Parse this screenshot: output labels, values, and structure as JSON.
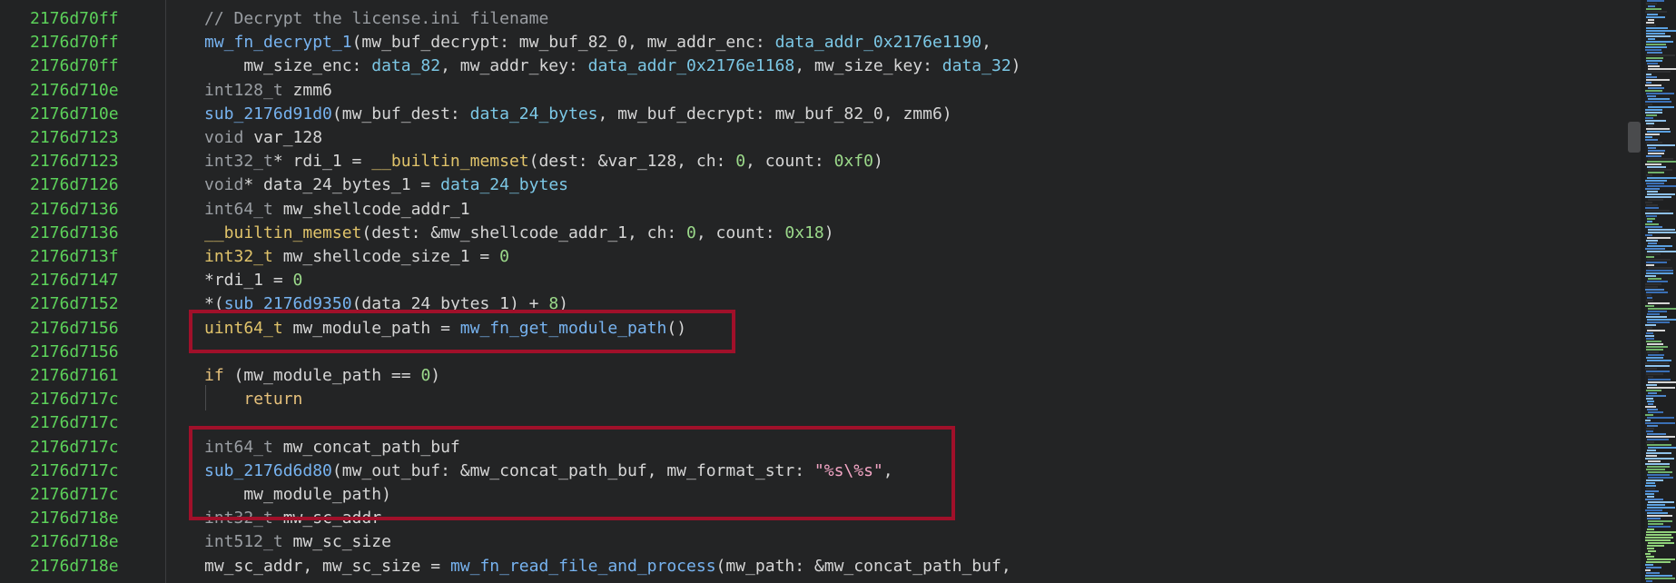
{
  "accent": "#a0102a",
  "line_numbers": [
    "2176d70ff",
    "2176d70ff",
    "2176d70ff",
    "2176d710e",
    "2176d710e",
    "2176d7123",
    "2176d7123",
    "2176d7126",
    "2176d7136",
    "2176d7136",
    "2176d713f",
    "2176d7147",
    "2176d7152",
    "2176d7156",
    "2176d7156",
    "2176d7161",
    "2176d717c",
    "2176d717c",
    "2176d717c",
    "2176d717c",
    "2176d717c",
    "2176d718e",
    "2176d718e",
    "2176d718e"
  ],
  "code_lines": [
    [
      {
        "t": "// Decrypt the license.ini filename",
        "c": "cmt"
      }
    ],
    [
      {
        "t": "mw_fn_decrypt_1",
        "c": "fn"
      },
      {
        "t": "(mw_buf_decrypt: mw_buf_82_0, mw_addr_enc: ",
        "c": "plain"
      },
      {
        "t": "data_addr_0x2176e1190",
        "c": "var"
      },
      {
        "t": ",",
        "c": "plain"
      }
    ],
    [
      {
        "t": "    mw_size_enc: ",
        "c": "plain"
      },
      {
        "t": "data_82",
        "c": "var"
      },
      {
        "t": ", mw_addr_key: ",
        "c": "plain"
      },
      {
        "t": "data_addr_0x2176e1168",
        "c": "var"
      },
      {
        "t": ", mw_size_key: ",
        "c": "plain"
      },
      {
        "t": "data_32",
        "c": "var"
      },
      {
        "t": ")",
        "c": "plain"
      }
    ],
    [
      {
        "t": "int128_t",
        "c": "dim"
      },
      {
        "t": " zmm6",
        "c": "plain"
      }
    ],
    [
      {
        "t": "sub_2176d91d0",
        "c": "fn"
      },
      {
        "t": "(mw_buf_dest: ",
        "c": "plain"
      },
      {
        "t": "data_24_bytes",
        "c": "var"
      },
      {
        "t": ", mw_buf_decrypt: mw_buf_82_0, zmm6)",
        "c": "plain"
      }
    ],
    [
      {
        "t": "void",
        "c": "dim"
      },
      {
        "t": " var_128",
        "c": "plain"
      }
    ],
    [
      {
        "t": "int32_t",
        "c": "dim"
      },
      {
        "t": "* rdi_1 = ",
        "c": "plain"
      },
      {
        "t": "__builtin_memset",
        "c": "type"
      },
      {
        "t": "(dest: &var_128, ch: ",
        "c": "plain"
      },
      {
        "t": "0",
        "c": "num"
      },
      {
        "t": ", count: ",
        "c": "plain"
      },
      {
        "t": "0xf0",
        "c": "num"
      },
      {
        "t": ")",
        "c": "plain"
      }
    ],
    [
      {
        "t": "void",
        "c": "dim"
      },
      {
        "t": "* data_24_bytes_1 = ",
        "c": "plain"
      },
      {
        "t": "data_24_bytes",
        "c": "var"
      }
    ],
    [
      {
        "t": "int64_t",
        "c": "dim"
      },
      {
        "t": " mw_shellcode_addr_1",
        "c": "plain"
      }
    ],
    [
      {
        "t": "__builtin_memset",
        "c": "type"
      },
      {
        "t": "(dest: &mw_shellcode_addr_1, ch: ",
        "c": "plain"
      },
      {
        "t": "0",
        "c": "num"
      },
      {
        "t": ", count: ",
        "c": "plain"
      },
      {
        "t": "0x18",
        "c": "num"
      },
      {
        "t": ")",
        "c": "plain"
      }
    ],
    [
      {
        "t": "int32_t",
        "c": "type"
      },
      {
        "t": " mw_shellcode_size_1 = ",
        "c": "plain"
      },
      {
        "t": "0",
        "c": "num"
      }
    ],
    [
      {
        "t": "*rdi_1 = ",
        "c": "plain"
      },
      {
        "t": "0",
        "c": "num"
      }
    ],
    [
      {
        "t": "*(",
        "c": "plain"
      },
      {
        "t": "sub_2176d9350",
        "c": "fn"
      },
      {
        "t": "(data_24_bytes_1) + ",
        "c": "plain"
      },
      {
        "t": "8",
        "c": "num"
      },
      {
        "t": ")",
        "c": "plain"
      }
    ],
    [
      {
        "t": "uint64_t",
        "c": "type"
      },
      {
        "t": " mw_module_path = ",
        "c": "plain"
      },
      {
        "t": "mw_fn_get_module_path",
        "c": "fn"
      },
      {
        "t": "()",
        "c": "plain"
      }
    ],
    [],
    [
      {
        "t": "if",
        "c": "kw"
      },
      {
        "t": " (mw_module_path == ",
        "c": "plain"
      },
      {
        "t": "0",
        "c": "num"
      },
      {
        "t": ")",
        "c": "plain"
      }
    ],
    [
      {
        "t": "    ",
        "c": "plain"
      },
      {
        "t": "return",
        "c": "kw"
      }
    ],
    [],
    [
      {
        "t": "int64_t",
        "c": "dim"
      },
      {
        "t": " mw_concat_path_buf",
        "c": "plain"
      }
    ],
    [
      {
        "t": "sub_2176d6d80",
        "c": "fn"
      },
      {
        "t": "(mw_out_buf: &mw_concat_path_buf, mw_format_str: ",
        "c": "plain"
      },
      {
        "t": "\"%s\\%s\"",
        "c": "str"
      },
      {
        "t": ",",
        "c": "plain"
      }
    ],
    [
      {
        "t": "    mw_module_path)",
        "c": "plain"
      }
    ],
    [
      {
        "t": "int32_t",
        "c": "dim"
      },
      {
        "t": " mw_sc_addr",
        "c": "plain"
      }
    ],
    [
      {
        "t": "int512_t",
        "c": "dim"
      },
      {
        "t": " mw_sc_size",
        "c": "plain"
      }
    ],
    [
      {
        "t": "mw_sc_addr, mw_sc_size = ",
        "c": "plain"
      },
      {
        "t": "mw_fn_read_file_and_process",
        "c": "fn"
      },
      {
        "t": "(mw_path: &mw_concat_path_buf,",
        "c": "plain"
      }
    ]
  ]
}
